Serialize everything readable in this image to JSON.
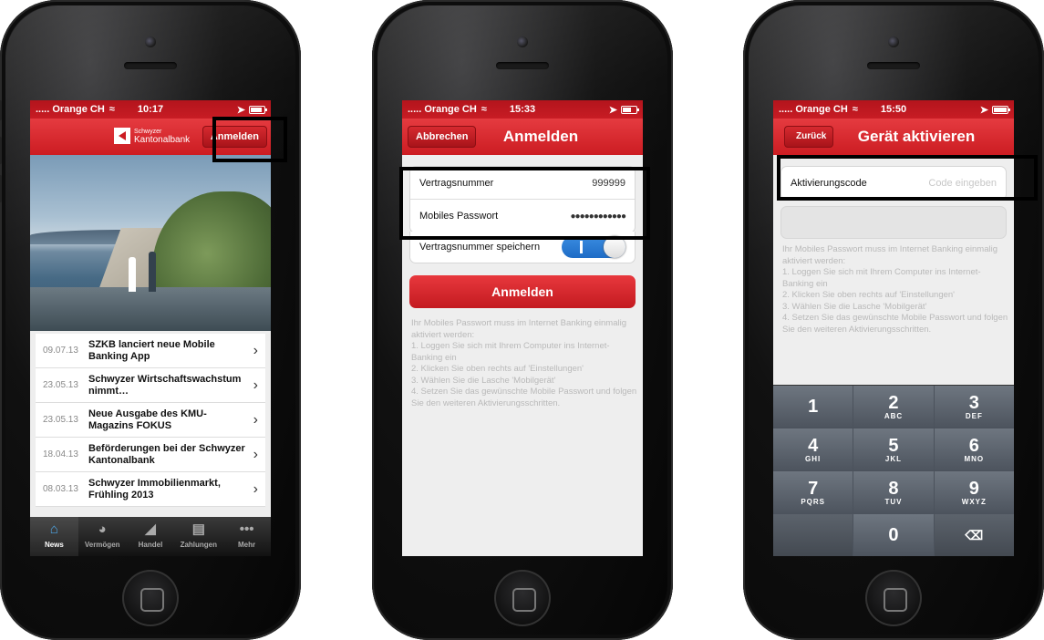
{
  "colors": {
    "brand_red": "#cc1c22",
    "toggle_blue": "#1e6cc6"
  },
  "phone1": {
    "status": {
      "carrier": "..... Orange CH",
      "time": "10:17"
    },
    "nav": {
      "login_button": "Anmelden",
      "logo_line1": "Schwyzer",
      "logo_line2": "Kantonalbank"
    },
    "news": [
      {
        "date": "09.07.13",
        "title": "SZKB lanciert neue Mobile Banking App"
      },
      {
        "date": "23.05.13",
        "title": "Schwyzer Wirtschaftswachstum nimmt…"
      },
      {
        "date": "23.05.13",
        "title": "Neue Ausgabe des KMU-Magazins FOKUS"
      },
      {
        "date": "18.04.13",
        "title": "Beförderungen bei der Schwyzer Kantonalbank"
      },
      {
        "date": "08.03.13",
        "title": "Schwyzer Immobilienmarkt, Frühling 2013"
      }
    ],
    "tabs": [
      {
        "label": "News",
        "icon": "home-icon"
      },
      {
        "label": "Vermögen",
        "icon": "pie-chart-icon"
      },
      {
        "label": "Handel",
        "icon": "chart-icon"
      },
      {
        "label": "Zahlungen",
        "icon": "card-icon"
      },
      {
        "label": "Mehr",
        "icon": "more-icon"
      }
    ]
  },
  "phone2": {
    "status": {
      "carrier": "..... Orange CH",
      "time": "15:33"
    },
    "nav": {
      "cancel_button": "Abbrechen",
      "title": "Anmelden"
    },
    "form": {
      "contract_label": "Vertragsnummer",
      "contract_value": "999999",
      "password_label": "Mobiles Passwort",
      "password_value": "●●●●●●●●●●●●",
      "save_label": "Vertragsnummer speichern"
    },
    "login_button": "Anmelden",
    "info": "Ihr Mobiles Passwort muss im Internet Banking einmalig aktiviert werden:\n1. Loggen Sie sich mit Ihrem Computer ins Internet-Banking ein\n2. Klicken Sie oben rechts auf 'Einstellungen'\n3. Wählen Sie die Lasche 'Mobilgerät'\n4. Setzen Sie das gewünschte Mobile Passwort und folgen Sie den weiteren Aktivierungsschritten."
  },
  "phone3": {
    "status": {
      "carrier": "..... Orange CH",
      "time": "15:50"
    },
    "nav": {
      "back_button": "Zurück",
      "title": "Gerät aktivieren"
    },
    "form": {
      "code_label": "Aktivierungscode",
      "code_placeholder": "Code eingeben"
    },
    "info": "Ihr Mobiles Passwort muss im Internet Banking einmalig aktiviert werden:\n1. Loggen Sie sich mit Ihrem Computer ins Internet-Banking ein\n2. Klicken Sie oben rechts auf 'Einstellungen'\n3. Wählen Sie die Lasche 'Mobilgerät'\n4. Setzen Sie das gewünschte Mobile Passwort und folgen Sie den weiteren Aktivierungsschritten.",
    "keys": [
      {
        "digit": "1",
        "letters": ""
      },
      {
        "digit": "2",
        "letters": "ABC"
      },
      {
        "digit": "3",
        "letters": "DEF"
      },
      {
        "digit": "4",
        "letters": "GHI"
      },
      {
        "digit": "5",
        "letters": "JKL"
      },
      {
        "digit": "6",
        "letters": "MNO"
      },
      {
        "digit": "7",
        "letters": "PQRS"
      },
      {
        "digit": "8",
        "letters": "TUV"
      },
      {
        "digit": "9",
        "letters": "WXYZ"
      },
      {
        "digit": "0",
        "letters": ""
      }
    ]
  }
}
